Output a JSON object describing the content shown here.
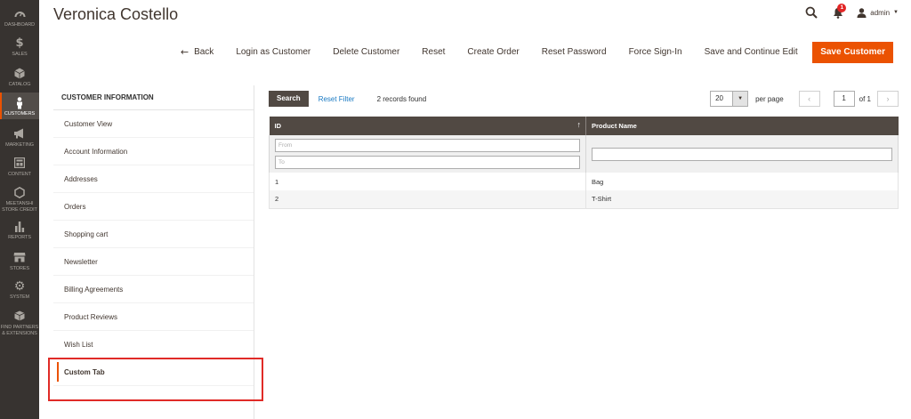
{
  "nav": [
    {
      "icon": "dashboard-icon",
      "label": "Dashboard",
      "active": false
    },
    {
      "icon": "dollar-icon",
      "label": "Sales",
      "active": false
    },
    {
      "icon": "box-icon",
      "label": "Catalog",
      "active": false
    },
    {
      "icon": "person-icon",
      "label": "Customers",
      "active": true
    },
    {
      "icon": "megaphone-icon",
      "label": "Marketing",
      "active": false
    },
    {
      "icon": "content-icon",
      "label": "Content",
      "active": false
    },
    {
      "icon": "hexagon-icon",
      "label": "Meetanshi",
      "label2": "Store Credit",
      "active": false
    },
    {
      "icon": "bar-chart-icon",
      "label": "Reports",
      "active": false
    },
    {
      "icon": "store-icon",
      "label": "Stores",
      "active": false
    },
    {
      "icon": "gear-icon",
      "label": "System",
      "active": false
    },
    {
      "icon": "cube-icon",
      "label": "Find Partners",
      "label2": "& Extensions",
      "active": false
    }
  ],
  "header": {
    "title": "Veronica Costello",
    "notifications_count": "1",
    "user": "admin"
  },
  "toolbar": {
    "back": "Back",
    "login_as_customer": "Login as Customer",
    "delete_customer": "Delete Customer",
    "reset": "Reset",
    "create_order": "Create Order",
    "reset_password": "Reset Password",
    "force_sign_in": "Force Sign-In",
    "save_continue": "Save and Continue Edit",
    "save_customer": "Save Customer"
  },
  "tabs": {
    "title": "Customer Information",
    "items": [
      {
        "label": "Customer View"
      },
      {
        "label": "Account Information"
      },
      {
        "label": "Addresses"
      },
      {
        "label": "Orders"
      },
      {
        "label": "Shopping cart"
      },
      {
        "label": "Newsletter"
      },
      {
        "label": "Billing Agreements"
      },
      {
        "label": "Product Reviews"
      },
      {
        "label": "Wish List"
      },
      {
        "label": "Custom Tab"
      }
    ]
  },
  "grid": {
    "search_label": "Search",
    "reset_filter_label": "Reset Filter",
    "records_found": "2 records found",
    "per_page_value": "20",
    "per_page_label": "per page",
    "current_page": "1",
    "total_pages": "of 1",
    "columns": {
      "id": "ID",
      "product_name": "Product Name"
    },
    "filters": {
      "from_placeholder": "From",
      "to_placeholder": "To"
    },
    "rows": [
      {
        "id": "1",
        "product_name": "Bag"
      },
      {
        "id": "2",
        "product_name": "T-Shirt"
      }
    ]
  },
  "colors": {
    "accent": "#eb5202",
    "nav_bg": "#373330",
    "grid_header": "#514943",
    "link": "#1979c3",
    "highlight": "#e02b27"
  }
}
